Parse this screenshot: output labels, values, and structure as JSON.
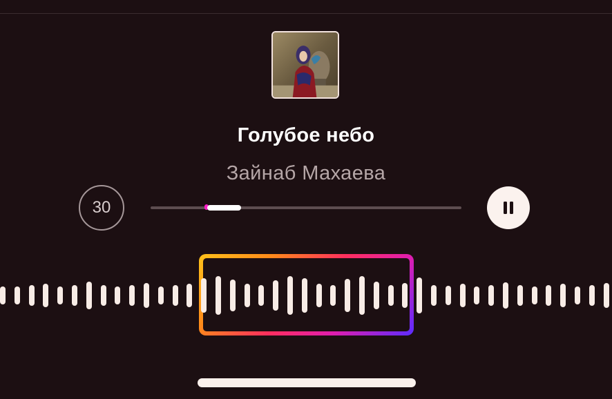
{
  "track": {
    "title": "Голубое небо",
    "artist": "Зайнаб Махаева"
  },
  "controls": {
    "skip_label": "30",
    "skip_icon": "skip-30-icon",
    "pause_icon": "pause-icon",
    "progress_fraction": 0.18
  },
  "waveform": {
    "accent_gradient": [
      "#ffc21a",
      "#ff2f5d",
      "#e01dae",
      "#5a2cff"
    ],
    "bar_color": "#f8ece6"
  },
  "colors": {
    "background": "#1c0f12",
    "title": "#ffffff",
    "artist": "#b5a6a7"
  }
}
